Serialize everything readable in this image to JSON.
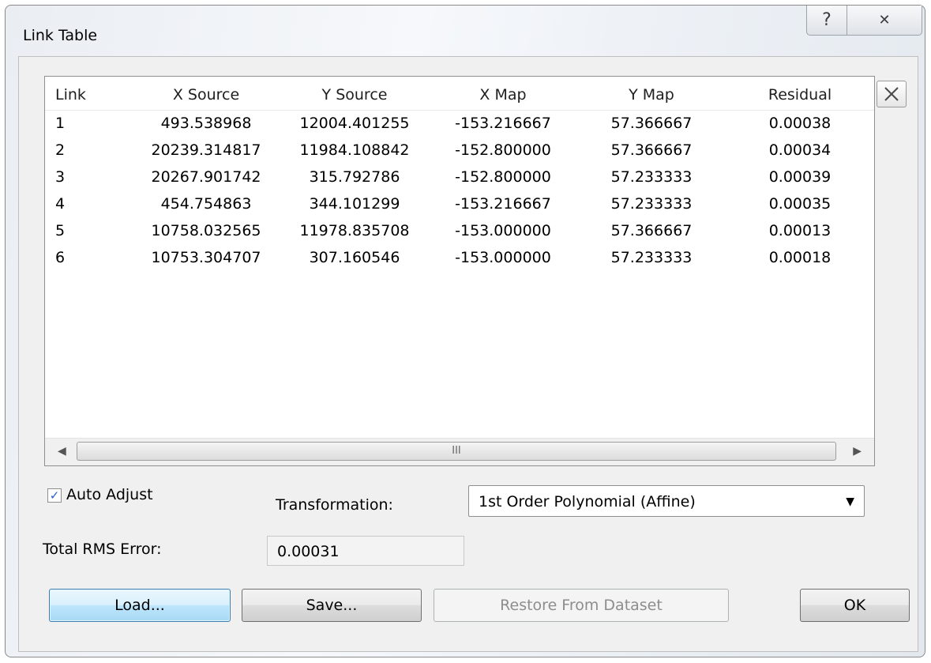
{
  "window": {
    "title": "Link Table",
    "help_glyph": "?",
    "close_glyph": "✕"
  },
  "table": {
    "headers": [
      "Link",
      "X Source",
      "Y Source",
      "X Map",
      "Y Map",
      "Residual"
    ],
    "rows": [
      [
        "1",
        "493.538968",
        "12004.401255",
        "-153.216667",
        "57.366667",
        "0.00038"
      ],
      [
        "2",
        "20239.314817",
        "11984.108842",
        "-152.800000",
        "57.366667",
        "0.00034"
      ],
      [
        "3",
        "20267.901742",
        "315.792786",
        "-152.800000",
        "57.233333",
        "0.00039"
      ],
      [
        "4",
        "454.754863",
        "344.101299",
        "-153.216667",
        "57.233333",
        "0.00035"
      ],
      [
        "5",
        "10758.032565",
        "11978.835708",
        "-153.000000",
        "57.366667",
        "0.00013"
      ],
      [
        "6",
        "10753.304707",
        "307.160546",
        "-153.000000",
        "57.233333",
        "0.00018"
      ]
    ],
    "scroll_thumb_grip": "III"
  },
  "controls": {
    "auto_adjust_label": "Auto Adjust",
    "auto_adjust_checked": true,
    "transformation_label": "Transformation:",
    "transformation_value": "1st Order Polynomial (Affine)",
    "rms_label": "Total RMS Error:",
    "rms_value": "0.00031"
  },
  "buttons": {
    "load": "Load...",
    "save": "Save...",
    "restore": "Restore From Dataset",
    "ok": "OK"
  },
  "icons": {
    "delete_link": "close-x-icon",
    "scroll_left": "scroll-left-arrow-icon",
    "scroll_right": "scroll-right-arrow-icon",
    "dropdown": "dropdown-arrow-icon",
    "checkmark": "checkmark-icon"
  },
  "colors": {
    "default_button_border": "#3c7fb1",
    "check_color": "#2a62c9",
    "disabled_text": "#8d8d8d"
  }
}
